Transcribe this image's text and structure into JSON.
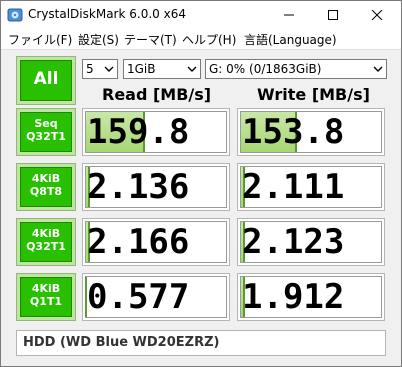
{
  "window": {
    "title": "CrystalDiskMark 6.0.0 x64",
    "app_icon": "crystaldiskmark-app-icon"
  },
  "menu": [
    {
      "label": "ファイル(F)"
    },
    {
      "label": "設定(S)"
    },
    {
      "label": "テーマ(T)"
    },
    {
      "label": "ヘルプ(H)"
    },
    {
      "label": "言語(Language)"
    }
  ],
  "controls": {
    "all_label": "All",
    "count": "5",
    "size": "1GiB",
    "drive": "G: 0% (0/1863GiB)"
  },
  "headers": {
    "read": "Read [MB/s]",
    "write": "Write [MB/s]"
  },
  "rows": [
    {
      "line1": "Seq",
      "line2": "Q32T1",
      "read": "159.8",
      "write": "153.8",
      "read_fill": 0.42,
      "write_fill": 0.4
    },
    {
      "line1": "4KiB",
      "line2": "Q8T8",
      "read": "2.136",
      "write": "2.111",
      "read_fill": 0.03,
      "write_fill": 0.03
    },
    {
      "line1": "4KiB",
      "line2": "Q32T1",
      "read": "2.166",
      "write": "2.123",
      "read_fill": 0.03,
      "write_fill": 0.03
    },
    {
      "line1": "4KiB",
      "line2": "Q1T1",
      "read": "0.577",
      "write": "1.912",
      "read_fill": 0.01,
      "write_fill": 0.03
    }
  ],
  "comment": "HDD (WD Blue WD20EZRZ)",
  "colors": {
    "tile_green": "#28c000",
    "bar_fill": "#a7d774"
  }
}
